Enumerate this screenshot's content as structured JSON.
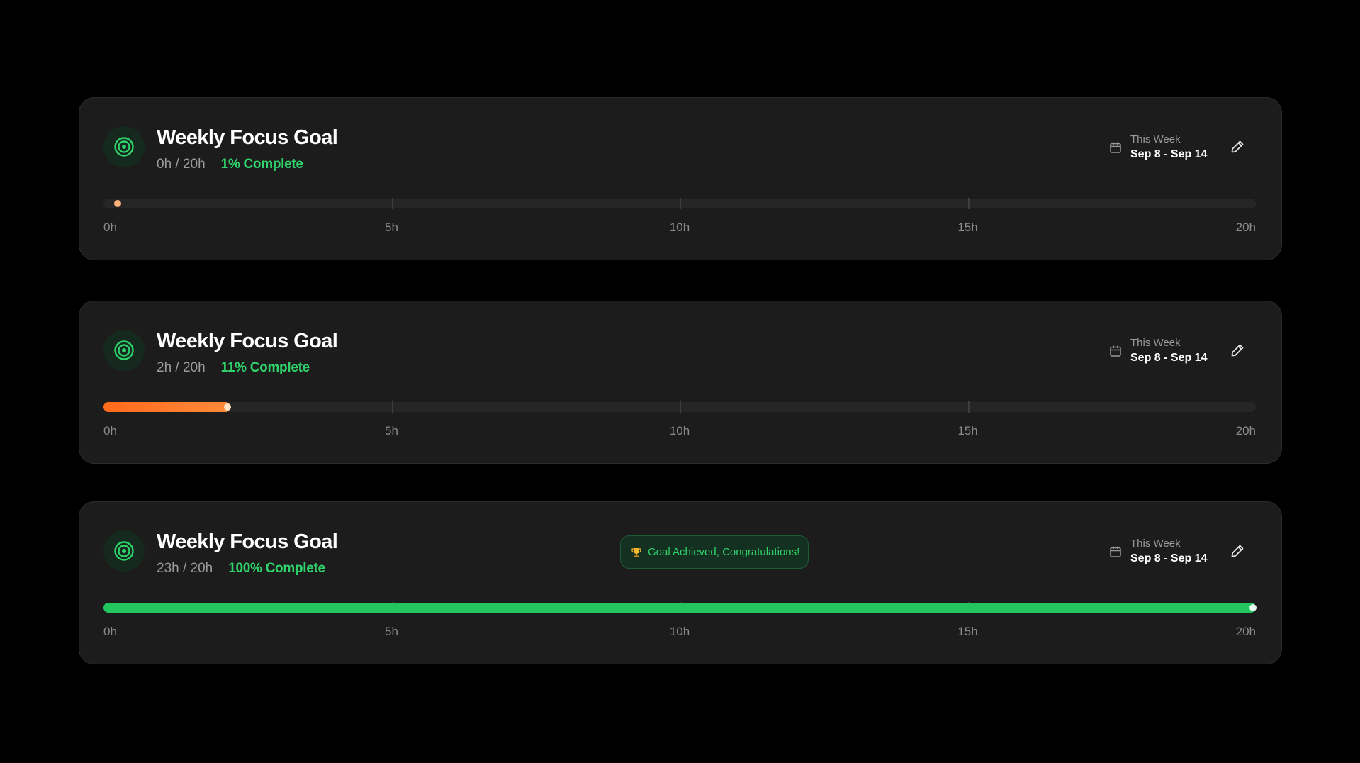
{
  "colors": {
    "background": "#000000",
    "card": "#1c1c1c",
    "accent_green": "#2fd26b",
    "progress_orange": "#ff7a2a",
    "progress_green": "#22c55e"
  },
  "axis": {
    "min_hours": 0,
    "max_hours": 20,
    "ticks": [
      "0h",
      "5h",
      "10h",
      "15h",
      "20h"
    ]
  },
  "cards": [
    {
      "icon": "target-icon",
      "title": "Weekly Focus Goal",
      "hours": "0h / 20h",
      "percent": "1% Complete",
      "progress_fraction": 0.01,
      "bar_color": "orange",
      "badge": null,
      "date_label": "This Week",
      "date_range": "Sep 8 - Sep 14",
      "edit_icon": "pencil-icon"
    },
    {
      "icon": "target-icon",
      "title": "Weekly Focus Goal",
      "hours": "2h / 20h",
      "percent": "11% Complete",
      "progress_fraction": 0.11,
      "bar_color": "orange",
      "badge": null,
      "date_label": "This Week",
      "date_range": "Sep 8 - Sep 14",
      "edit_icon": "pencil-icon"
    },
    {
      "icon": "target-icon",
      "title": "Weekly Focus Goal",
      "hours": "23h / 20h",
      "percent": "100% Complete",
      "progress_fraction": 1.0,
      "bar_color": "green",
      "badge": {
        "icon": "trophy-icon",
        "text": "Goal Achieved, Congratulations!"
      },
      "date_label": "This Week",
      "date_range": "Sep 8 - Sep 14",
      "edit_icon": "pencil-icon"
    }
  ]
}
